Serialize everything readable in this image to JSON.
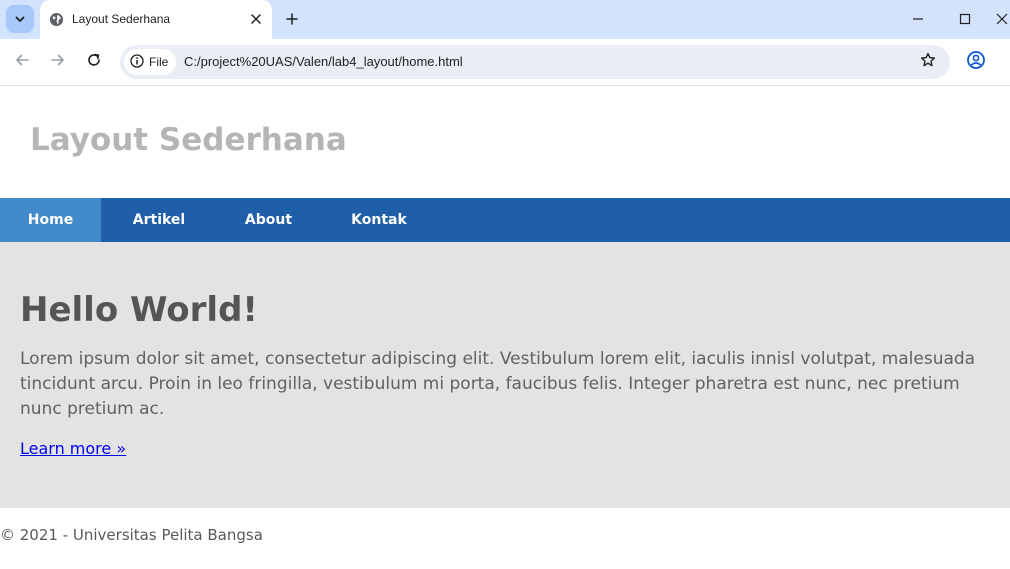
{
  "browser": {
    "tab": {
      "title": "Layout Sederhana"
    },
    "address_bar": {
      "site_chip": "File",
      "url": "C:/project%20UAS/Valen/lab4_layout/home.html"
    },
    "icons": {
      "tab_search": "chevron-down-icon",
      "favicon": "globe-icon",
      "tab_close": "close-icon",
      "new_tab": "plus-icon",
      "back": "back-arrow-icon",
      "forward": "forward-arrow-icon",
      "reload": "reload-icon",
      "site_info": "info-icon",
      "bookmark": "star-icon",
      "profile": "profile-icon",
      "minimize": "minimize-icon",
      "maximize": "maximize-icon",
      "close_window": "close-icon"
    }
  },
  "page": {
    "header": {
      "title": "Layout Sederhana"
    },
    "nav": {
      "items": [
        {
          "label": "Home",
          "active": true
        },
        {
          "label": "Artikel",
          "active": false
        },
        {
          "label": "About",
          "active": false
        },
        {
          "label": "Kontak",
          "active": false
        }
      ]
    },
    "hero": {
      "title": "Hello World!",
      "text": "Lorem ipsum dolor sit amet, consectetur adipiscing elit. Vestibulum lorem elit, iaculis innisl volutpat, malesuada tincidunt arcu. Proin in leo fringilla, vestibulum mi porta, faucibus felis. Integer pharetra est nunc, nec pretium nunc pretium ac.",
      "link": "Learn more »"
    },
    "footer": {
      "text": "© 2021 - Universitas Pelita Bangsa"
    }
  },
  "colors": {
    "tabstrip_bg": "#d3e3fd",
    "nav_bg": "#1f5faa",
    "nav_active_bg": "#428bca",
    "hero_bg": "#e3e3e3",
    "site_title": "#b5b5b5",
    "link": "#0000ee"
  }
}
